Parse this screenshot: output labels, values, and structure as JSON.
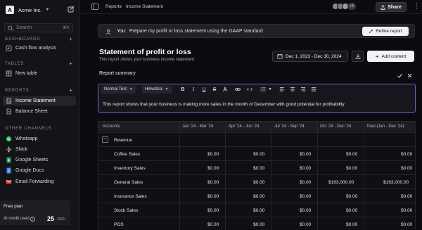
{
  "workspace": {
    "name": "Acme Inc.",
    "logo_letter": "A"
  },
  "search": {
    "placeholder": "Search",
    "shortcut": "⌘K"
  },
  "sidebar": {
    "dashboards_label": "DASHBOARDS",
    "dashboards": [
      {
        "label": "Cash flow analysis"
      }
    ],
    "tables_label": "TABLES",
    "tables": [
      {
        "label": "New table"
      }
    ],
    "reports_label": "REPORTS",
    "reports": [
      {
        "label": "Income Statement"
      },
      {
        "label": "Balance Sheet"
      }
    ],
    "channels_label": "OTHER CHANNELS",
    "channels": [
      {
        "label": "Whatsapp",
        "icon": "whatsapp-icon"
      },
      {
        "label": "Slack",
        "icon": "slack-icon"
      },
      {
        "label": "Google Sheets",
        "icon": "google-sheets-icon"
      },
      {
        "label": "Google Docs",
        "icon": "google-docs-icon"
      },
      {
        "label": "Email Forwarding",
        "icon": "email-icon"
      }
    ]
  },
  "plan": {
    "title": "Free plan",
    "credit_label": "AI credit used",
    "used": "25",
    "max": "/100"
  },
  "topbar": {
    "breadcrumb": [
      "Reports",
      "Income Statement"
    ],
    "extra_collaborators": "+5",
    "share_label": "Share"
  },
  "prompt": {
    "you_label": "You:",
    "text": "Prepare my profit or loss statement using the GAAP standard",
    "refine_label": "Refine report"
  },
  "statement": {
    "title": "Statement of profit or loss",
    "subtitle": "This report shows your business income statement",
    "date_range": "Dec 1, 2023 - Dec 30, 2024",
    "add_content_label": "Add content"
  },
  "summary": {
    "label": "Report summary",
    "text_style": "Normal Text",
    "font": "Helvetica",
    "text": "This report shows that your business is making more sales in the month of December with good potential for profitability."
  },
  "table": {
    "headers": [
      "Accounts",
      "Jan '24 - Mar '24",
      "Apr '24 - Jun '24",
      "Jul '24 - Sep '24",
      "Oct '24 - Dec '24",
      "Total (Jan - Dec '24)"
    ],
    "group": "Revenue",
    "rows": [
      {
        "account": "Coffee Sales",
        "q1": "$0.00",
        "q2": "$0.00",
        "q3": "$0.00",
        "q4": "$0.00",
        "total": "$0.00"
      },
      {
        "account": "Inventory Sales",
        "q1": "$0.00",
        "q2": "$0.00",
        "q3": "$0.00",
        "q4": "$0.00",
        "total": "$0.00"
      },
      {
        "account": "General Sales",
        "q1": "$0.00",
        "q2": "$0.00",
        "q3": "$0.00",
        "q4": "$193,000.00",
        "total": "$193,000.00"
      },
      {
        "account": "Insurance Sales",
        "q1": "$0.00",
        "q2": "$0.00",
        "q3": "$0.00",
        "q4": "$0.00",
        "total": "$0.00"
      },
      {
        "account": "Stock Sales",
        "q1": "$0.00",
        "q2": "$0.00",
        "q3": "$0.00",
        "q4": "$0.00",
        "total": "$0.00"
      },
      {
        "account": "POS",
        "q1": "$0.00",
        "q2": "$0.00",
        "q3": "$0.00",
        "q4": "$0.00",
        "total": "$0.00"
      }
    ]
  }
}
